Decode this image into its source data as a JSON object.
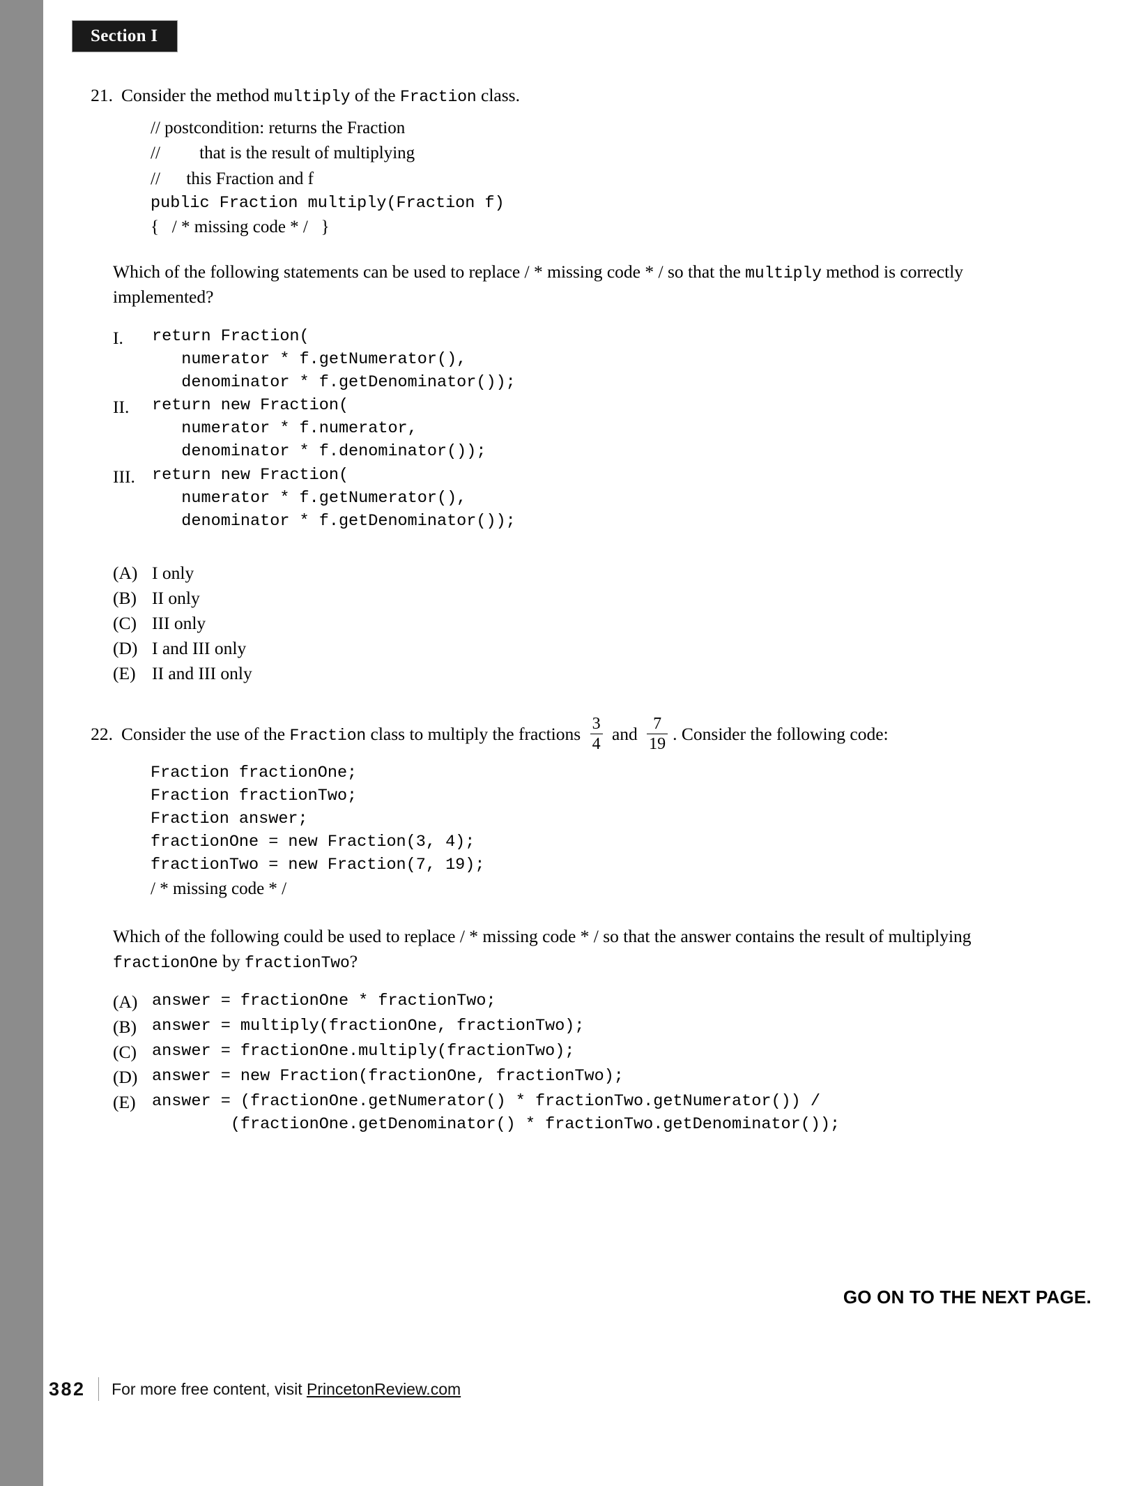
{
  "section_tag": "Section I",
  "questions": [
    {
      "number": "21.",
      "stem_parts": {
        "p1": "Consider the method ",
        "mono1": "multiply",
        "p2": " of the ",
        "mono2": "Fraction",
        "p3": " class."
      },
      "code_lines": [
        "// postcondition: returns the Fraction",
        "//         that is the result of multiplying",
        "//      this Fraction and f",
        "public Fraction multiply(Fraction f)",
        "{   / * missing code * /   }"
      ],
      "prompt_parts": {
        "a": "Which of the following statements can be used to replace ",
        "b": " / * missing code * / ",
        "c": "so that the ",
        "d": "multiply",
        "e": " method is correctly implemented?"
      },
      "roman_options": [
        {
          "label": "I.",
          "lines": [
            "return Fraction(",
            "   numerator * f.getNumerator(),",
            "   denominator * f.getDenominator());"
          ]
        },
        {
          "label": "II.",
          "lines": [
            "return new Fraction(",
            "   numerator * f.numerator,",
            "   denominator * f.denominator());"
          ]
        },
        {
          "label": "III.",
          "lines": [
            "return new Fraction(",
            "   numerator * f.getNumerator(),",
            "   denominator * f.getDenominator());"
          ]
        }
      ],
      "choices": [
        {
          "label": "(A)",
          "text": "I only"
        },
        {
          "label": "(B)",
          "text": "II only"
        },
        {
          "label": "(C)",
          "text": "III only"
        },
        {
          "label": "(D)",
          "text": "I and III only"
        },
        {
          "label": "(E)",
          "text": "II and III only"
        }
      ]
    },
    {
      "number": "22.",
      "stem_parts": {
        "p1": "Consider the use of the ",
        "mono1": "Fraction",
        "p2": " class to multiply the fractions ",
        "frac1_num": "3",
        "frac1_den": "4",
        "p3": " and ",
        "frac2_num": "7",
        "frac2_den": "19",
        "p4": ". Consider the following code:"
      },
      "code_lines": [
        "Fraction fractionOne;",
        "Fraction fractionTwo;",
        "Fraction answer;",
        "fractionOne = new Fraction(3, 4);",
        "fractionTwo = new Fraction(7, 19);",
        "/ * missing code * /"
      ],
      "prompt_parts": {
        "a": "Which of the following could be used to replace ",
        "b": "/ * missing code * / ",
        "c": " so that the answer contains the result of multiplying ",
        "d": "fractionOne",
        "e": " by ",
        "f": "fractionTwo",
        "g": "?"
      },
      "choices": [
        {
          "label": "(A)",
          "text": "answer = fractionOne * fractionTwo;"
        },
        {
          "label": "(B)",
          "text": "answer = multiply(fractionOne, fractionTwo);"
        },
        {
          "label": "(C)",
          "text": "answer = fractionOne.multiply(fractionTwo);"
        },
        {
          "label": "(D)",
          "text": "answer = new Fraction(fractionOne, fractionTwo);"
        },
        {
          "label": "(E)",
          "text": "answer = (fractionOne.getNumerator() * fractionTwo.getNumerator()) /\n        (fractionOne.getDenominator() * fractionTwo.getDenominator());"
        }
      ]
    }
  ],
  "go_on_notice": "GO ON TO THE NEXT PAGE.",
  "footer": {
    "page_number": "382",
    "blurb_prefix": "For more free content, visit ",
    "blurb_link": "PrincetonReview.com"
  }
}
